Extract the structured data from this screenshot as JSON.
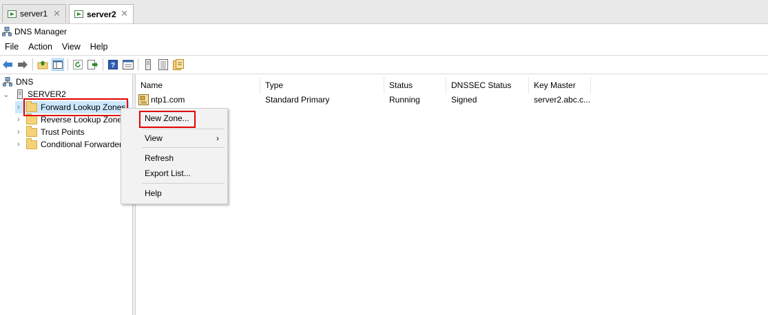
{
  "tabs": [
    {
      "label": "server1",
      "active": false
    },
    {
      "label": "server2",
      "active": true
    }
  ],
  "window": {
    "title": "DNS Manager"
  },
  "menu": [
    "File",
    "Action",
    "View",
    "Help"
  ],
  "tree": {
    "root": "DNS",
    "server": "SERVER2",
    "children": [
      "Forward Lookup Zones",
      "Reverse Lookup Zones",
      "Trust Points",
      "Conditional Forwarders"
    ]
  },
  "list": {
    "columns": [
      "Name",
      "Type",
      "Status",
      "DNSSEC Status",
      "Key Master"
    ],
    "rows": [
      {
        "name": "ntp1.com",
        "type": "Standard Primary",
        "status": "Running",
        "dnssec": "Signed",
        "key_master": "server2.abc.c..."
      }
    ]
  },
  "context_menu": {
    "items": [
      "New Zone...",
      "View",
      "Refresh",
      "Export List...",
      "Help"
    ]
  },
  "colors": {
    "highlight": "#e00000",
    "selection": "#cce8ff"
  }
}
